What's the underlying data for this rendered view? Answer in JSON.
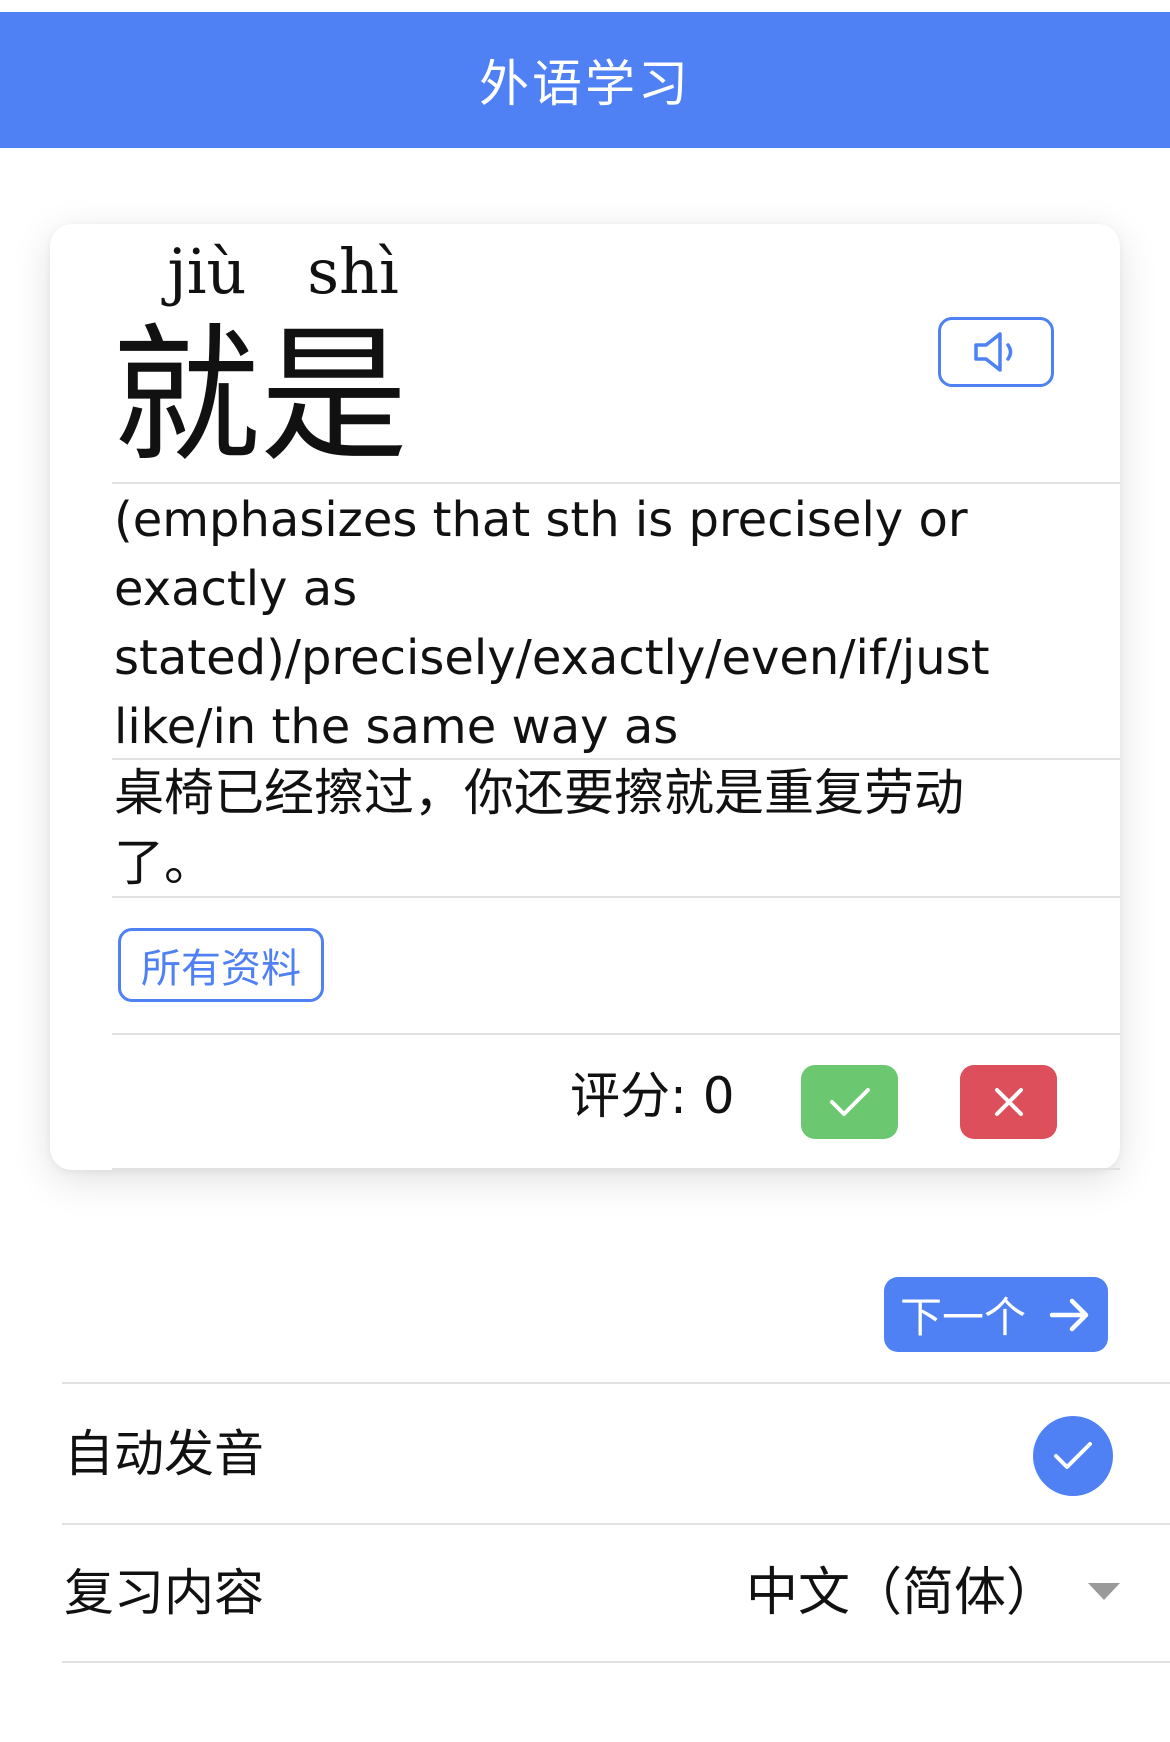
{
  "header": {
    "title": "外语学习"
  },
  "card": {
    "pinyin": [
      "jiù",
      "shì"
    ],
    "word": "就是",
    "speak_icon": "speaker-icon",
    "definition_lines": [
      "(emphasizes that sth is precisely or",
      "exactly as",
      "stated)/precisely/exactly/even/if/just",
      "like/in the same way as"
    ],
    "example_lines": [
      "桌椅已经擦过，你还要擦就是重复劳动",
      "了。"
    ],
    "all_info_label": "所有资料",
    "score_label": "评分: 0",
    "correct_icon": "check-icon",
    "wrong_icon": "close-icon"
  },
  "next": {
    "label": "下一个",
    "icon": "arrow-right-icon"
  },
  "settings": {
    "auto_pronounce_label": "自动发音",
    "auto_pronounce_enabled": true,
    "review_content_label": "复习内容",
    "review_content_value": "中文（简体）",
    "review_content_icon": "caret-down-icon"
  },
  "colors": {
    "accent": "#4f81f4",
    "correct": "#6cc870",
    "wrong": "#dc4f5b",
    "divider": "#e1e1e1"
  }
}
